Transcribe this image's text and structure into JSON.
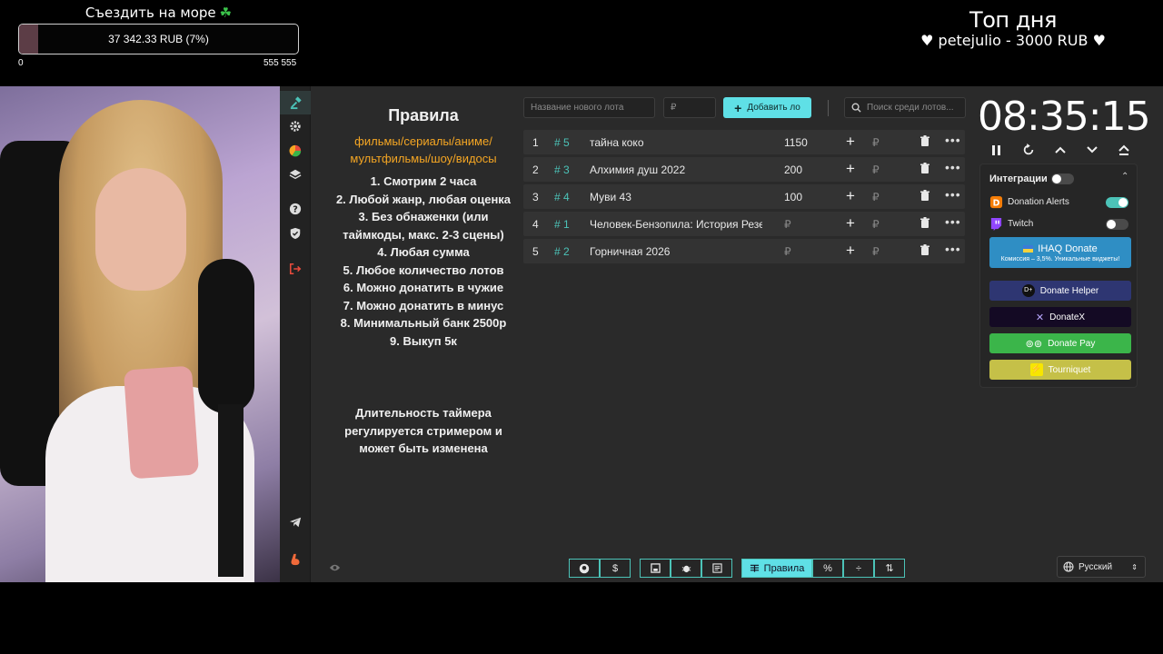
{
  "overlay": {
    "goal_title": "Съездить на море",
    "goal_icon": "clover-icon",
    "goal_text": "37 342.33 RUB (7%)",
    "goal_progress": 0.07,
    "goal_min": "0",
    "goal_max": "555 555",
    "top_title": "Топ дня",
    "top_line": "petejulio - 3000 RUB"
  },
  "sidebar": {
    "items": [
      "auction-icon",
      "gear-icon",
      "pie-chart-icon",
      "layers-icon",
      "help-icon",
      "shield-icon",
      "logout-icon",
      "telegram-icon",
      "boosty-icon"
    ]
  },
  "rules": {
    "title": "Правила",
    "genres": "фильмы/сериалы/аниме/ мультфильмы/шоу/видосы",
    "items": [
      "1. Смотрим 2 часа",
      "2. Любой жанр, любая оценка",
      "3. Без обнаженки (или таймкоды, макс. 2-3 сцены)",
      "4. Любая сумма",
      "5. Любое количество лотов",
      "6. Можно донатить в чужие",
      "7. Можно донатить в минус",
      "8. Минимальный банк 2500р",
      "9. Выкуп 5к"
    ],
    "timer_note": "Длительность таймера регулируется стримером и может быть изменена"
  },
  "toolbar": {
    "new_lot_placeholder": "Название нового лота",
    "amount_placeholder": "₽",
    "add_label": "Добавить ло",
    "search_placeholder": "Поиск среди лотов..."
  },
  "lots": [
    {
      "num": "1",
      "id": "# 5",
      "name": "тайна коко",
      "amount": "1150"
    },
    {
      "num": "2",
      "id": "# 3",
      "name": "Алхимия душ 2022",
      "amount": "200"
    },
    {
      "num": "3",
      "id": "# 4",
      "name": "Муви 43",
      "amount": "100"
    },
    {
      "num": "4",
      "id": "# 1",
      "name": "Человек-Бензопила: История Резе",
      "amount": "₽"
    },
    {
      "num": "5",
      "id": "# 2",
      "name": "Горничная 2026",
      "amount": "₽"
    }
  ],
  "lot_rub": "₽",
  "timer": {
    "value": "08:35:15"
  },
  "integrations": {
    "title": "Интеграции",
    "donation_alerts": "Donation Alerts",
    "twitch": "Twitch",
    "ihaq_title": "IHAQ Donate",
    "ihaq_sub": "Комиссия – 3,5%. Уникальные виджеты!",
    "donate_helper": "Donate Helper",
    "donatex": "DonateX",
    "donate_pay": "Donate Pay",
    "tourniquet": "Tourniquet"
  },
  "bottombar": {
    "rules_label": "Правила",
    "percent_label": "%",
    "divide_label": "÷",
    "sort_label": "⇅"
  },
  "language": "Русский",
  "colors": {
    "accent": "#5fe0e6",
    "lot_id": "#4cc3b8",
    "rules_genres": "#f5a623"
  }
}
